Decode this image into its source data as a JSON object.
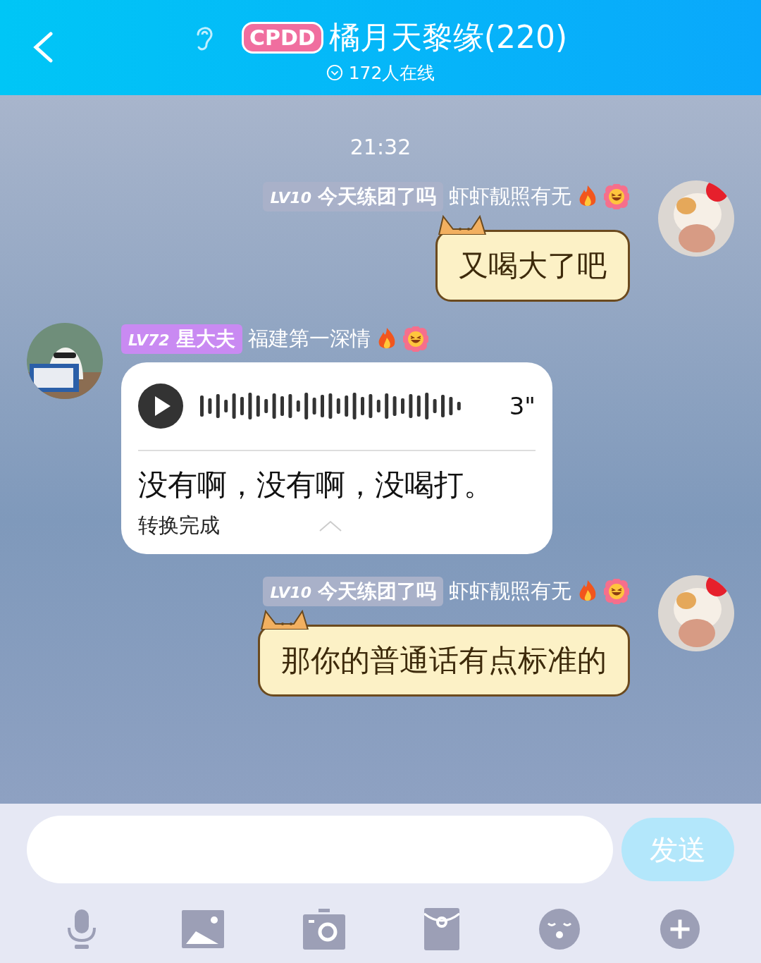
{
  "header": {
    "logo": "CPDD",
    "title": "橘月天黎缘(220)",
    "online": "172人在线"
  },
  "time": "21:32",
  "messages": [
    {
      "kind": "sent",
      "level": "LV10",
      "title": "今天练团了吗",
      "color": "#a9b1c9",
      "name": "虾虾靓照有无",
      "text": "又喝大了吧"
    },
    {
      "kind": "voice",
      "level": "LV72",
      "title": "星大夫",
      "color": "#c98af2",
      "name": "福建第一深情",
      "duration": "3\"",
      "text": "没有啊，没有啊，没喝打。",
      "status": "转换完成"
    },
    {
      "kind": "sent",
      "level": "LV10",
      "title": "今天练团了吗",
      "color": "#a9b1c9",
      "name": "虾虾靓照有无",
      "text": "那你的普通话有点标准的"
    }
  ],
  "input": {
    "send": "发送",
    "send_disabled": true
  }
}
